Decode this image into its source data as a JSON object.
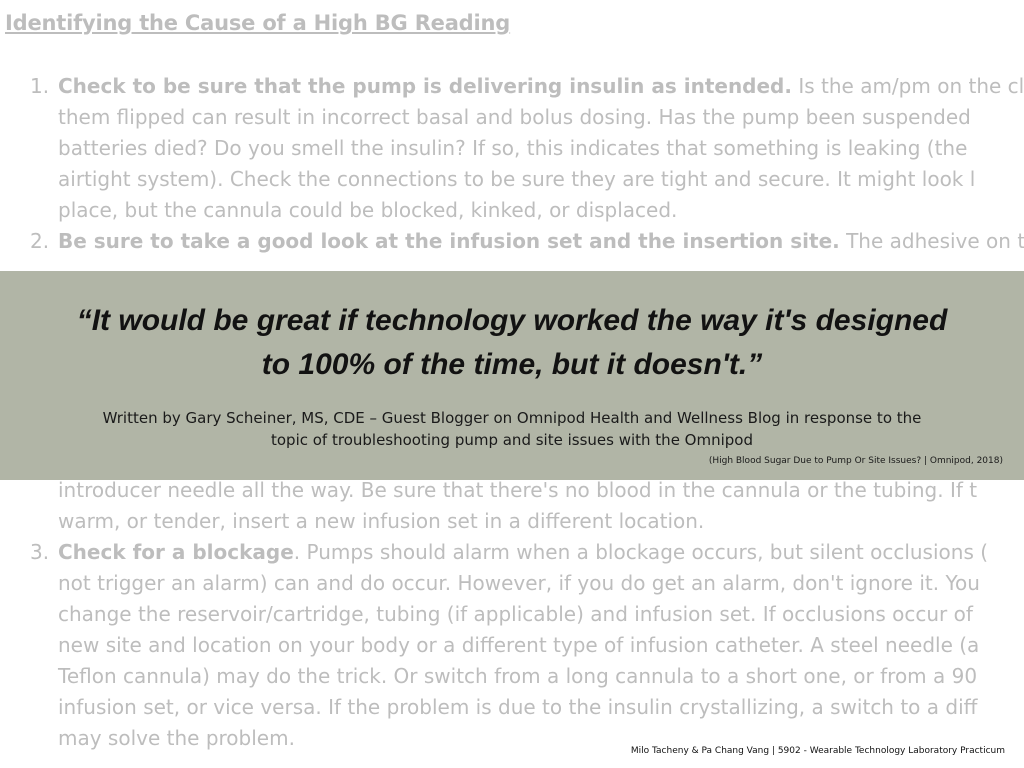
{
  "document": {
    "title": "Identifying the Cause of a High BG Reading",
    "items": [
      {
        "number": "1.",
        "bold": "Check to be sure that the pump is delivering insulin as intended.",
        "lines": [
          " Is the am/pm on the cl",
          "them flipped can result in incorrect basal and bolus dosing. Has the pump been suspended",
          "batteries died? Do you smell the insulin? If so, this indicates that something is leaking (the",
          "airtight system). Check the connections to be sure they are tight and secure. It might look l",
          "place, but the cannula could be blocked, kinked, or displaced."
        ]
      },
      {
        "number": "2.",
        "bold": "Be sure to take a good look at the infusion set and the insertion site.",
        "lines": [
          " The adhesive on the",
          "introducer needle all the way. Be sure that there's no blood in the cannula or the tubing. If t",
          "warm, or tender, insert a new infusion set in a different location."
        ]
      },
      {
        "number": "3.",
        "bold": "Check for a blockage",
        "lines": [
          ". Pumps should alarm when a blockage occurs, but silent occlusions (",
          "not trigger an alarm) can and do occur. However, if you do get an alarm, don't ignore it. You",
          "change the reservoir/cartridge, tubing (if applicable) and infusion set. If occlusions occur of",
          "new site and location on your body or a different type of infusion catheter. A steel needle (a",
          "Teflon cannula) may do the trick. Or switch from a long cannula to a short one, or from a 90",
          "infusion set, or vice versa. If the problem is due to the insulin crystallizing, a switch to a diff",
          "may solve the problem."
        ]
      }
    ]
  },
  "banner": {
    "quote_line1": "“It would be great if technology worked the way it's designed",
    "quote_line2": "to 100% of the time, but it doesn't.”",
    "attribution_line1": "Written by Gary Scheiner, MS, CDE – Guest Blogger on Omnipod Health and Wellness Blog in response to the",
    "attribution_line2": "topic of troubleshooting pump and site issues with the Omnipod",
    "citation": "(High Blood Sugar Due to Pump Or Site Issues? | Omnipod, 2018)"
  },
  "footer": {
    "credit": "Milo Tacheny & Pa Chang Vang  | 5902 - Wearable Technology Laboratory Practicum"
  },
  "colors": {
    "banner_background": "#b1b5a6",
    "faded_text": "#bdbdbd",
    "quote_text": "#121212"
  }
}
